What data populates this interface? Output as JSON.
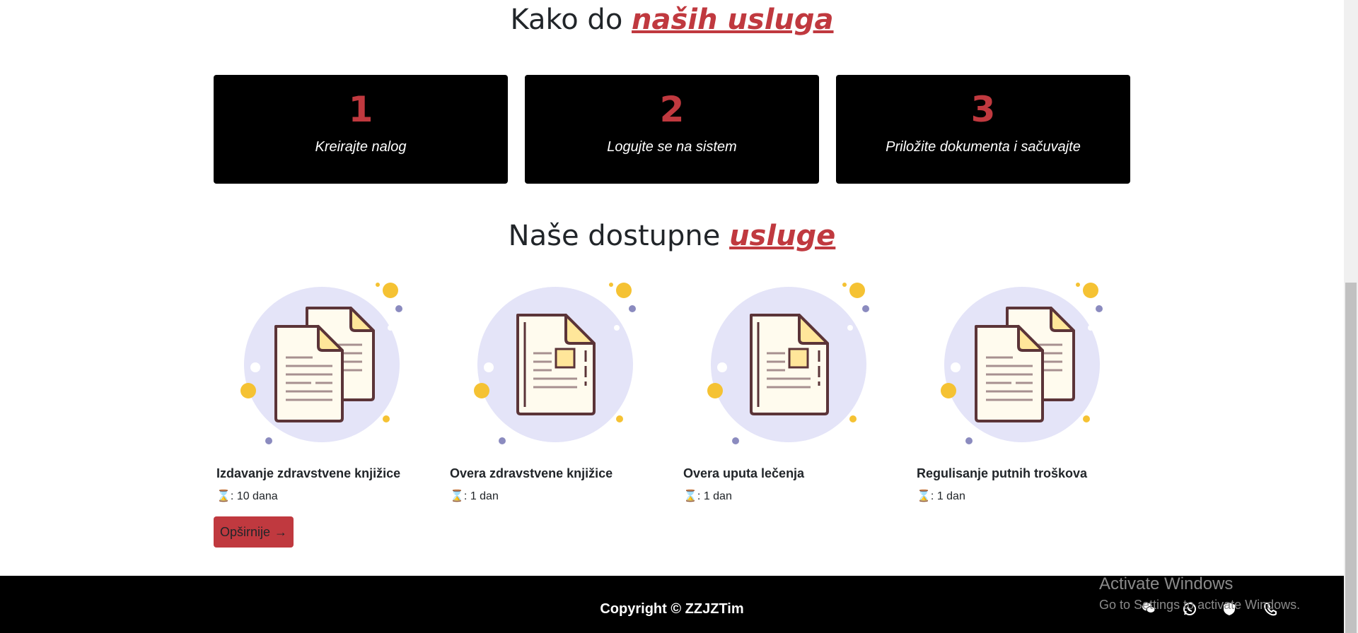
{
  "howto": {
    "title_plain": "Kako do ",
    "title_accent": "naših usluga",
    "steps": [
      {
        "num": "1",
        "label": "Kreirajte nalog"
      },
      {
        "num": "2",
        "label": "Logujte se na sistem"
      },
      {
        "num": "3",
        "label": "Priložite dokumenta i sačuvajte"
      }
    ]
  },
  "services": {
    "title_plain": "Naše dostupne ",
    "title_accent": "usluge",
    "items": [
      {
        "title": "Izdavanje zdravstvene knjižice",
        "time_icon": "⌛",
        "time": ": 10 dana",
        "icon": "two-documents-icon"
      },
      {
        "title": "Overa zdravstvene knjižice",
        "time_icon": "⌛",
        "time": ": 1 dan",
        "icon": "single-document-icon"
      },
      {
        "title": "Overa uputa lečenja",
        "time_icon": "⌛",
        "time": ": 1 dan",
        "icon": "single-document-icon"
      },
      {
        "title": "Regulisanje putnih troškova",
        "time_icon": "⌛",
        "time": ": 1 dan",
        "icon": "two-documents-icon"
      }
    ],
    "more_button": "Opširnije",
    "more_arrow": "→"
  },
  "footer": {
    "copyright": "Copyright © ZZJZTim"
  },
  "windows_watermark": {
    "line1": "Activate Windows",
    "line2": "Go to Settings to activate Windows."
  },
  "colors": {
    "accent": "#c0393f",
    "step_bg": "#000000",
    "illustration_circle": "#e4e4f8",
    "paper": "#fffbee",
    "paper_fold": "#ffe69a",
    "dot_yellow": "#f5c233",
    "dot_purple": "#8b8bbf"
  }
}
